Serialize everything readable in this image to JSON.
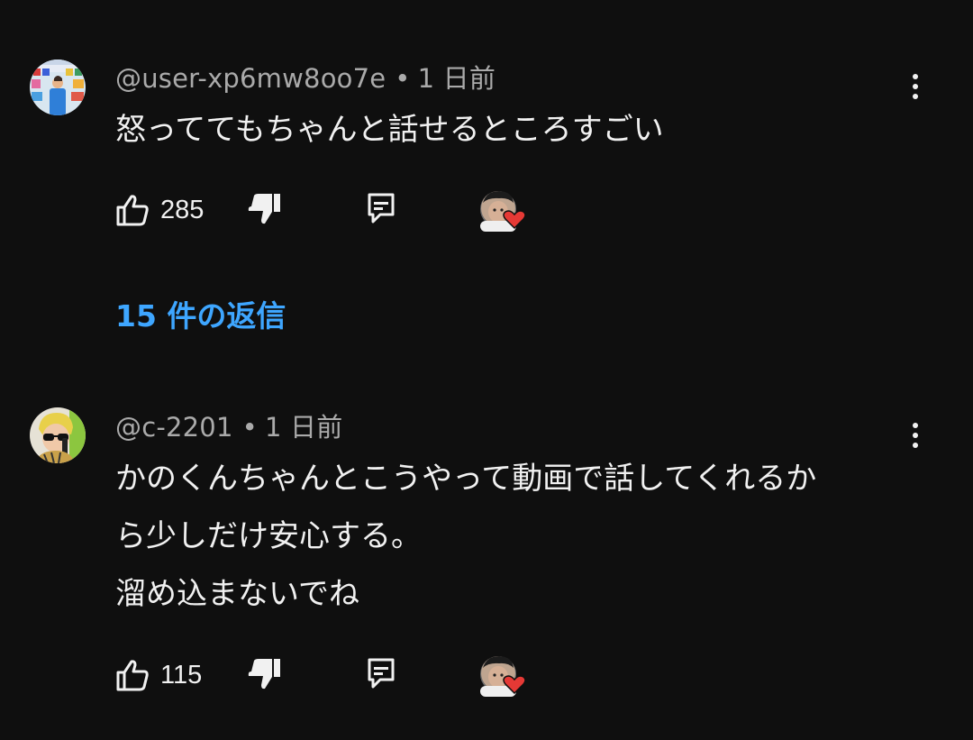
{
  "comments": [
    {
      "handle": "@user-xp6mw8oo7e",
      "separator": "•",
      "time": "1 日前",
      "lines": [
        "怒っててもちゃんと話せるところすごい"
      ],
      "likes": "285",
      "icons": {
        "like": "thumbs-up-icon",
        "dislike": "thumbs-down-icon",
        "reply": "reply-icon",
        "menu": "more-vert-icon",
        "heart": "creator-heart-icon"
      },
      "replies_label": "15 件の返信"
    },
    {
      "handle": "@c-2201",
      "separator": "•",
      "time": "1 日前",
      "lines": [
        "かのくんちゃんとこうやって動画で話してくれるか",
        "ら少しだけ安心する。",
        "溜め込まないでね"
      ],
      "likes": "115"
    }
  ],
  "colors": {
    "background": "#0f0f0f",
    "text": "#f1f1f1",
    "meta": "#aaaaaa",
    "link": "#3ea6ff",
    "heart": "#e53935"
  }
}
